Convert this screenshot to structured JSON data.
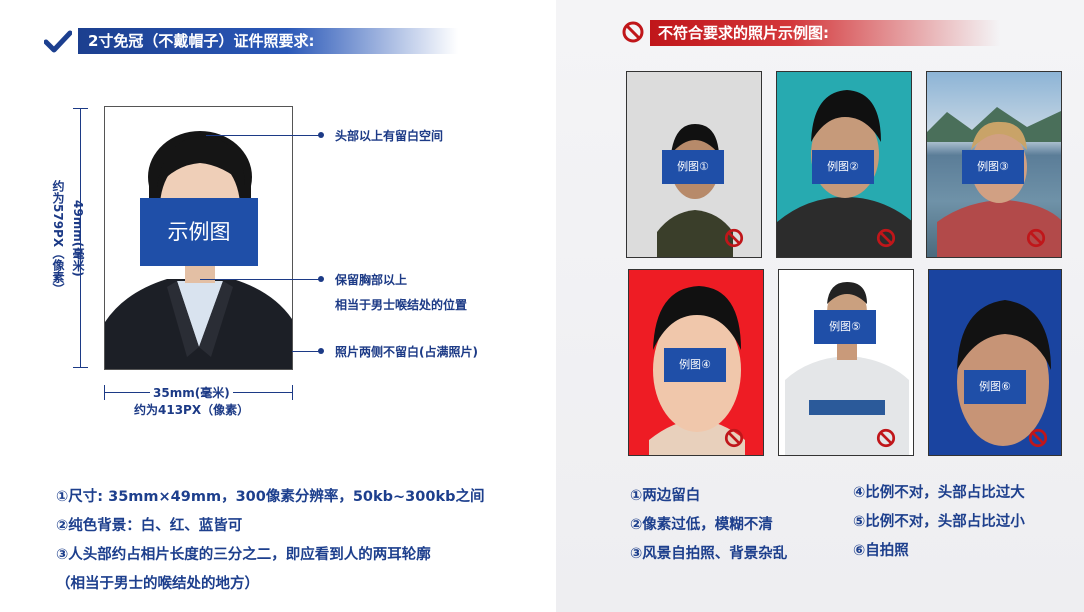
{
  "left_header": {
    "title": "2寸免冠（不戴帽子）证件照要求:"
  },
  "right_header": {
    "title": "不符合要求的照片示例图:"
  },
  "sample": {
    "label": "示例图",
    "height_mm": "49mm(毫米)",
    "height_px": "约为579PX（像素）",
    "width_mm": "35mm(毫米)",
    "width_px": "约为413PX（像素）",
    "annotations": [
      {
        "text": "头部以上有留白空间"
      },
      {
        "text": "保留胸部以上"
      },
      {
        "text": "相当于男士喉结处的位置"
      },
      {
        "text": "照片两侧不留白(占满照片)"
      }
    ]
  },
  "requirements": [
    "①尺寸: 35mm×49mm，300像素分辨率，50kb~300kb之间",
    "②纯色背景：白、红、蓝皆可",
    "③人头部约占相片长度的三分之二，即应看到人的两耳轮廓",
    "（相当于男士的喉结处的地方）"
  ],
  "examples": [
    {
      "label": "例图①",
      "bg": "#dcdcdc"
    },
    {
      "label": "例图②",
      "bg": "#27aab0"
    },
    {
      "label": "例图③",
      "bg": "#7ea6c8"
    },
    {
      "label": "例图④",
      "bg": "#ee1c24"
    },
    {
      "label": "例图⑤",
      "bg": "#ffffff"
    },
    {
      "label": "例图⑥",
      "bg": "#1a44a0"
    }
  ],
  "reasons_col1": [
    "①两边留白",
    "②像素过低，模糊不清",
    "③风景自拍照、背景杂乱"
  ],
  "reasons_col2": [
    "④比例不对，头部占比过大",
    "⑤比例不对，头部占比过小",
    "⑥自拍照"
  ],
  "icons": [
    "check-icon",
    "prohibited-icon"
  ],
  "colors": {
    "brand_blue": "#1f4fa8",
    "alert_red": "#c0161a"
  }
}
